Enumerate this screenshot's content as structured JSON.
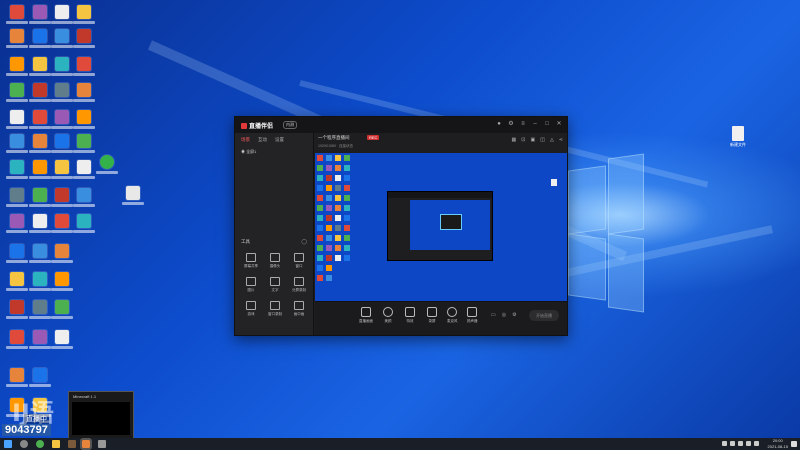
{
  "colors": {
    "wallpaper": "#0d4ccc",
    "app_bg": "#1e1e20",
    "accent": "#e23a3a",
    "taskbar": "#1a1e26"
  },
  "app": {
    "name": "直播伴侣",
    "version_badge": "内测",
    "sidebar_tabs": [
      "场景",
      "互动",
      "设置"
    ],
    "scene_label": "全屏1",
    "tools_header": "工具",
    "tools": [
      "屏幕共享",
      "摄像头",
      "窗口",
      "图片",
      "文字",
      "分屏录制",
      "游戏",
      "窗口录制",
      "画中画"
    ],
    "stream_title": "一个程序直播间",
    "rec_badge": "REC",
    "status": "1920X1080 · 连接状态",
    "controls": [
      "直播画面",
      "美颜",
      "特效",
      "录屏",
      "麦克风",
      "扬声器"
    ],
    "start_button": "开始直播"
  },
  "popup": {
    "title": "Minecraft 1.1"
  },
  "overlay": {
    "big_text": "IJ语",
    "badge": "直播中",
    "room_id": "9043797"
  },
  "taskbar": {
    "time": "20:00",
    "date": "2021-08-15"
  },
  "desktop_icons": {
    "left_columns": 4,
    "file_right": "新建文件"
  }
}
